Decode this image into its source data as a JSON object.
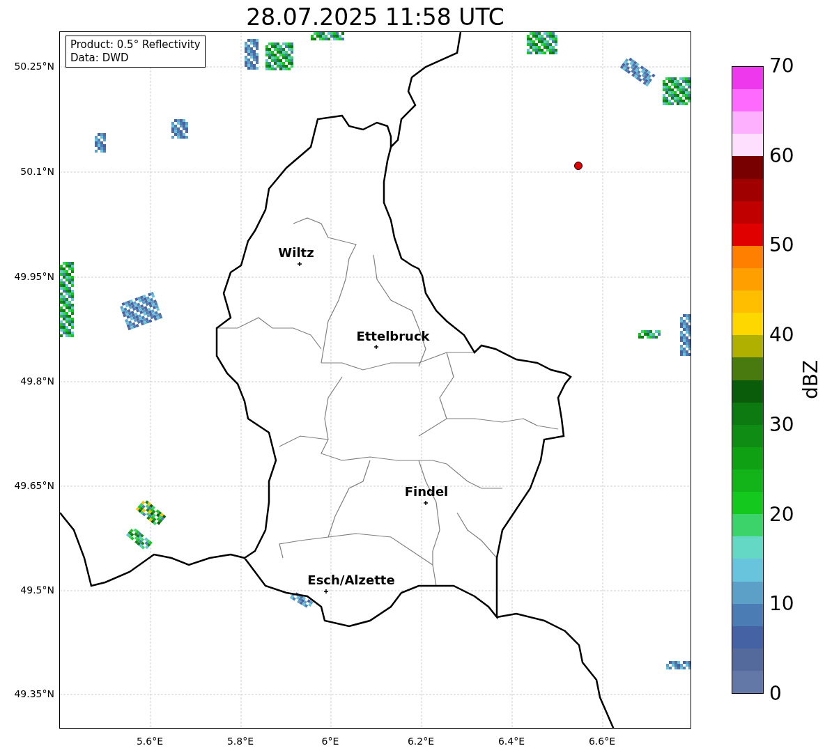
{
  "title": "28.07.2025 11:58 UTC",
  "info_box": [
    "Product: 0.5° Reflectivity",
    "Data: DWD"
  ],
  "y_ticks": [
    "50.25°N",
    "50.1°N",
    "49.95°N",
    "49.8°N",
    "49.65°N",
    "49.5°N",
    "49.35°N"
  ],
  "x_ticks": [
    "5.6°E",
    "5.8°E",
    "6°E",
    "6.2°E",
    "6.4°E",
    "6.6°E"
  ],
  "cities": [
    {
      "name": "Wiltz"
    },
    {
      "name": "Ettelbruck"
    },
    {
      "name": "Findel"
    },
    {
      "name": "Esch/Alzette"
    }
  ],
  "colorbar": {
    "label": "dBZ",
    "ticks": [
      "70",
      "60",
      "50",
      "40",
      "30",
      "20",
      "10",
      "0"
    ],
    "segments": [
      {
        "color": "#ee38ee"
      },
      {
        "color": "#fd6afd"
      },
      {
        "color": "#fdb0fd"
      },
      {
        "color": "#fee0fe"
      },
      {
        "color": "#780000"
      },
      {
        "color": "#a00000"
      },
      {
        "color": "#c00000"
      },
      {
        "color": "#e00000"
      },
      {
        "color": "#ff7f00"
      },
      {
        "color": "#ff9f00"
      },
      {
        "color": "#ffbf00"
      },
      {
        "color": "#ffd700"
      },
      {
        "color": "#b0b000"
      },
      {
        "color": "#487a10"
      },
      {
        "color": "#0a5c0a"
      },
      {
        "color": "#0c7a10"
      },
      {
        "color": "#0e8c14"
      },
      {
        "color": "#10a014"
      },
      {
        "color": "#12b41a"
      },
      {
        "color": "#14c81e"
      },
      {
        "color": "#3cd46a"
      },
      {
        "color": "#64d8c4"
      },
      {
        "color": "#68c4dc"
      },
      {
        "color": "#5ca0c8"
      },
      {
        "color": "#4c7cb4"
      },
      {
        "color": "#4462a4"
      },
      {
        "color": "#54699c"
      },
      {
        "color": "#6478a8"
      }
    ]
  }
}
